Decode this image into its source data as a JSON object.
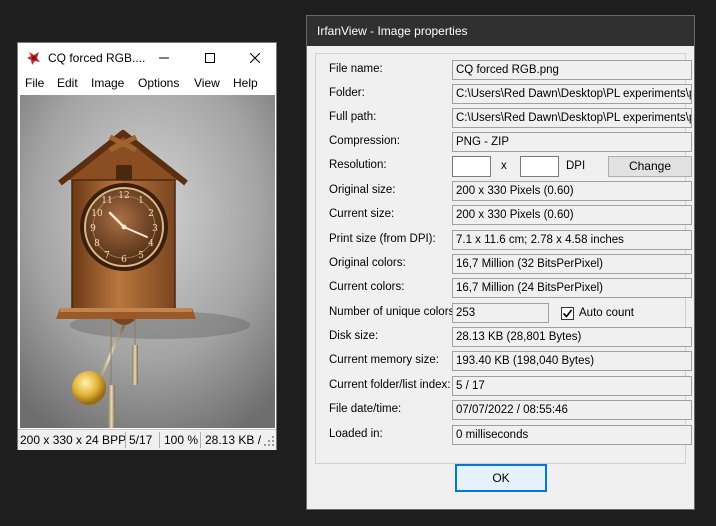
{
  "viewer": {
    "title": "CQ forced RGB....",
    "menu": [
      "File",
      "Edit",
      "Image",
      "Options",
      "View",
      "Help"
    ],
    "status": {
      "dims": "200 x 330 x 24 BPP",
      "index": "5/17",
      "zoom": "100 %",
      "size": "28.13 KB /"
    }
  },
  "dialog": {
    "title": "IrfanView - Image properties",
    "rows": [
      {
        "label": "File name:",
        "value": "CQ forced RGB.png"
      },
      {
        "label": "Folder:",
        "value": "C:\\Users\\Red Dawn\\Desktop\\PL experiments\\pr"
      },
      {
        "label": "Full path:",
        "value": "C:\\Users\\Red Dawn\\Desktop\\PL experiments\\pr"
      },
      {
        "label": "Compression:",
        "value": "PNG - ZIP"
      }
    ],
    "resolution": {
      "label": "Resolution:",
      "x_value": "",
      "y_value": "",
      "separator": "x",
      "unit": "DPI",
      "change_label": "Change"
    },
    "rows2": [
      {
        "label": "Original size:",
        "value": "200 x 330  Pixels (0.60)"
      },
      {
        "label": "Current size:",
        "value": "200 x 330  Pixels (0.60)"
      },
      {
        "label": "Print size (from DPI):",
        "value": "7.1 x 11.6 cm; 2.78 x 4.58 inches"
      },
      {
        "label": "Original colors:",
        "value": "16,7 Million  (32 BitsPerPixel)"
      },
      {
        "label": "Current colors:",
        "value": "16,7 Million  (24 BitsPerPixel)"
      }
    ],
    "unique_colors": {
      "label": "Number of unique colors:",
      "value": "253",
      "auto_count_label": "Auto count",
      "auto_count_checked": true
    },
    "rows3": [
      {
        "label": "Disk size:",
        "value": "28.13 KB (28,801 Bytes)"
      },
      {
        "label": "Current memory size:",
        "value": "193.40  KB  (198,040 Bytes)"
      },
      {
        "label": "Current folder/list index:",
        "value": "5  /  17"
      },
      {
        "label": "File date/time:",
        "value": "07/07/2022 / 08:55:46"
      },
      {
        "label": "Loaded in:",
        "value": "0 milliseconds"
      }
    ],
    "ok_label": "OK"
  },
  "colors": {
    "dialog_title_bg": "#303030",
    "ok_border": "#0078d7",
    "desktop_bg": "#1e1e1e"
  }
}
